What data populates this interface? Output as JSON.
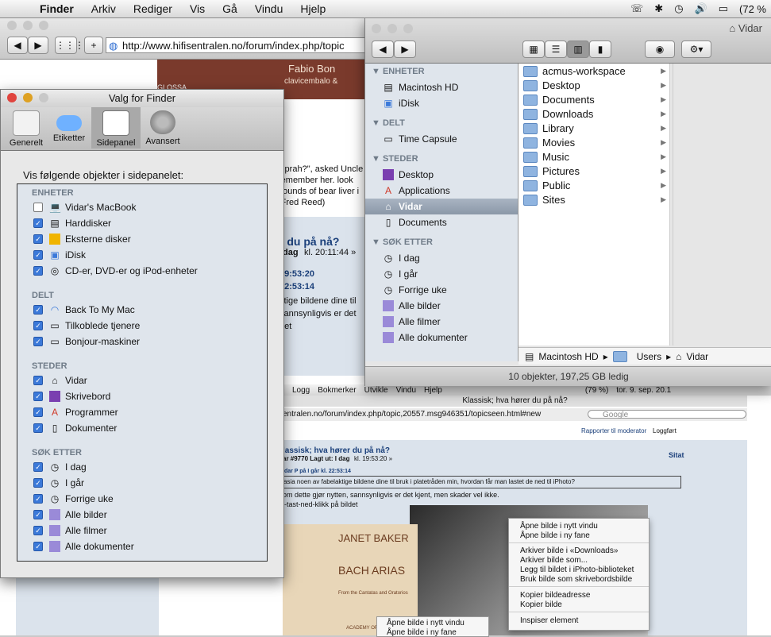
{
  "menubar": {
    "app": "Finder",
    "items": [
      "Arkiv",
      "Rediger",
      "Vis",
      "Gå",
      "Vindu",
      "Hjelp"
    ],
    "battery": "(72 %"
  },
  "browser": {
    "url": "http://www.hifisentralen.no/forum/index.php/topic",
    "banner_text": "Fabio Bon",
    "banner_sub": "clavicembalo &",
    "banner_label": "GLOSSA",
    "post_lines": [
      "Oprah?\", asked Uncle",
      "remember her. look",
      "pounds of bear liver i",
      "(Fred Reed)"
    ],
    "thread_title": "r du på nå?",
    "thread_meta_bold": "dag",
    "thread_meta": "kl. 20:11:44 »",
    "time1": "19:53:20",
    "time2": "22:53:14",
    "reply_lines": [
      "ktige bildene dine til",
      "sannsynligvis er det",
      "det"
    ]
  },
  "prefs": {
    "title": "Valg for Finder",
    "tabs": [
      "Generelt",
      "Etiketter",
      "Sidepanel",
      "Avansert"
    ],
    "heading": "Vis følgende objekter i sidepanelet:",
    "sections": [
      {
        "title": "ENHETER",
        "items": [
          {
            "label": "Vidar's MacBook",
            "checked": false,
            "icon": "laptop-icon"
          },
          {
            "label": "Harddisker",
            "checked": true,
            "icon": "harddisk-icon"
          },
          {
            "label": "Eksterne disker",
            "checked": true,
            "icon": "external-disk-icon"
          },
          {
            "label": "iDisk",
            "checked": true,
            "icon": "idisk-icon"
          },
          {
            "label": "CD-er, DVD-er og iPod-enheter",
            "checked": true,
            "icon": "cd-icon"
          }
        ]
      },
      {
        "title": "DELT",
        "items": [
          {
            "label": "Back To My Mac",
            "checked": true,
            "icon": "back-to-my-mac-icon"
          },
          {
            "label": "Tilkoblede tjenere",
            "checked": true,
            "icon": "server-icon"
          },
          {
            "label": "Bonjour-maskiner",
            "checked": true,
            "icon": "bonjour-icon"
          }
        ]
      },
      {
        "title": "STEDER",
        "items": [
          {
            "label": "Vidar",
            "checked": true,
            "icon": "home-icon"
          },
          {
            "label": "Skrivebord",
            "checked": true,
            "icon": "desktop-icon"
          },
          {
            "label": "Programmer",
            "checked": true,
            "icon": "applications-icon"
          },
          {
            "label": "Dokumenter",
            "checked": true,
            "icon": "documents-icon"
          }
        ]
      },
      {
        "title": "SØK ETTER",
        "items": [
          {
            "label": "I dag",
            "checked": true,
            "icon": "clock-icon"
          },
          {
            "label": "I går",
            "checked": true,
            "icon": "clock-icon"
          },
          {
            "label": "Forrige uke",
            "checked": true,
            "icon": "clock-icon"
          },
          {
            "label": "Alle bilder",
            "checked": true,
            "icon": "smart-folder-icon"
          },
          {
            "label": "Alle filmer",
            "checked": true,
            "icon": "smart-folder-icon"
          },
          {
            "label": "Alle dokumenter",
            "checked": true,
            "icon": "smart-folder-icon"
          }
        ]
      }
    ]
  },
  "finder": {
    "title": "Vidar",
    "sidebar": [
      {
        "title": "ENHETER",
        "items": [
          "Macintosh HD",
          "iDisk"
        ]
      },
      {
        "title": "DELT",
        "items": [
          "Time Capsule"
        ]
      },
      {
        "title": "STEDER",
        "items": [
          "Desktop",
          "Applications",
          "Vidar",
          "Documents"
        ]
      },
      {
        "title": "SØK ETTER",
        "items": [
          "I dag",
          "I går",
          "Forrige uke",
          "Alle bilder",
          "Alle filmer",
          "Alle dokumenter"
        ]
      }
    ],
    "selected": "Vidar",
    "column": [
      "acmus-workspace",
      "Desktop",
      "Documents",
      "Downloads",
      "Library",
      "Movies",
      "Music",
      "Pictures",
      "Public",
      "Sites"
    ],
    "path": [
      "Macintosh HD",
      "Users",
      "Vidar"
    ],
    "status": "10 objekter, 197,25 GB ledig"
  },
  "inner": {
    "menus": [
      "Logg",
      "Bokmerker",
      "Utvikle",
      "Vindu",
      "Hjelp"
    ],
    "battery": "(79 %)",
    "clock": "tor. 9. sep. 20.1",
    "title": "Klassisk; hva hører du på nå?",
    "url": "entralen.no/forum/index.php/topic,20557.msg946351/topicseen.html#new",
    "search_placeholder": "Google",
    "report": "Rapporter til moderator",
    "logged": "Loggført",
    "thread": "lassisk; hva hører du på nå?",
    "meta_bold": "ar #9770 Lagt ut: I dag",
    "meta": "kl. 19:53:20 »",
    "quote_btn": "Sitat",
    "quote_head": "idar P på I går kl. 22:53:14",
    "quote_text": "asia noen av fabelaktige bildene dine til bruk i platetråden min, hvordan får man lastet de ned til iPhoto?",
    "body1": "om dette gjør nytten, sannsynligvis er det kjent, men skader vel ikke.",
    "body2": "l-tast-ned-klikk på bildet",
    "album_artist": "JANET BAKER",
    "album_title": "BACH ARIAS",
    "album_sub": "From the Cantatas and Oratorios",
    "album_label": "ACADEMY OF"
  },
  "context_menu": {
    "group1": [
      "Åpne bilde i nytt vindu",
      "Åpne bilde i ny fane"
    ],
    "group2": [
      "Arkiver bilde i «Downloads»",
      "Arkiver bilde som...",
      "Legg til bildet i iPhoto-biblioteket",
      "Bruk bilde som skrivebordsbilde"
    ],
    "group3": [
      "Kopier bildeadresse",
      "Kopier bilde"
    ],
    "group4": [
      "Inspiser element"
    ]
  },
  "context_menu2": [
    "Åpne bilde i nytt vindu",
    "Åpne bilde i ny fane"
  ]
}
